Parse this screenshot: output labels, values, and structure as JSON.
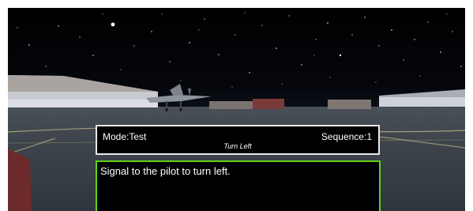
{
  "hud": {
    "mode_label": "Mode:",
    "mode_value": "Test",
    "sequence_label": "Sequence:",
    "sequence_value": "1",
    "command": "Turn Left"
  },
  "instruction": {
    "text": "Signal to the pilot to turn left."
  },
  "scene": {
    "description_icons": [
      "moon-icon",
      "aircraft-icon"
    ],
    "colors": {
      "sky": "#000000",
      "ground": "#3e444c",
      "hud_border": "#e8e8e8",
      "message_border": "#5fd21b",
      "hangar_light": "#b9bcc4",
      "red_building": "#7a3a3a"
    }
  }
}
